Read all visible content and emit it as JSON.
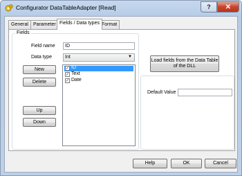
{
  "window": {
    "title": "Configurator DataTableAdapter [Read]",
    "help_glyph": "?",
    "close_glyph": "✕"
  },
  "tabs": [
    {
      "label": "General"
    },
    {
      "label": "Parameter"
    },
    {
      "label": "Fields / Data types"
    },
    {
      "label": "Format"
    }
  ],
  "active_tab": "Fields / Data types",
  "fields": {
    "group_label": "Fields",
    "field_name_label": "Field name",
    "field_name_value": "ID",
    "data_type_label": "Data type",
    "data_type_value": "Int",
    "new_label": "New",
    "delete_label": "Delete",
    "up_label": "Up",
    "down_label": "Down",
    "items": [
      {
        "label": "ID",
        "checked": true,
        "selected": true
      },
      {
        "label": "Text",
        "checked": true,
        "selected": false
      },
      {
        "label": "Date",
        "checked": true,
        "selected": false
      }
    ]
  },
  "load_button_label": "Load fields from the Data Table of the DLL",
  "default_value_label": "Default Value",
  "default_value": "",
  "footer": {
    "help_label": "Help",
    "ok_label": "OK",
    "cancel_label": "Cancel"
  },
  "colors": {
    "selection": "#3399ff",
    "close_button": "#c7432c"
  }
}
